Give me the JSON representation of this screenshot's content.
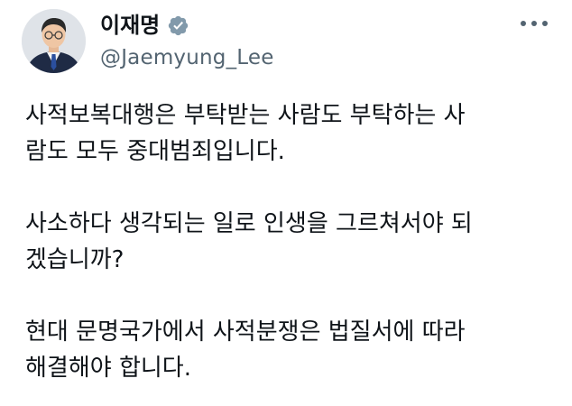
{
  "author": {
    "display_name": "이재명",
    "handle": "@Jaemyung_Lee",
    "verified_icon": "verified-badge-icon",
    "avatar_icon": "avatar"
  },
  "menu_icon": "more-options-icon",
  "tweet": {
    "paragraphs": [
      [
        "사적보복대행은 부탁받는 사람도 부탁하는 사",
        "람도 모두 중대범죄입니다."
      ],
      [
        "사소하다 생각되는 일로 인생을 그르쳐서야 되",
        "겠습니까?"
      ],
      [
        "현대 문명국가에서 사적분쟁은 법질서에 따라",
        "해결해야 합니다."
      ]
    ]
  },
  "colors": {
    "text_primary": "#0f1419",
    "text_secondary": "#536471",
    "verified_badge": "#829aab",
    "background": "#ffffff"
  }
}
